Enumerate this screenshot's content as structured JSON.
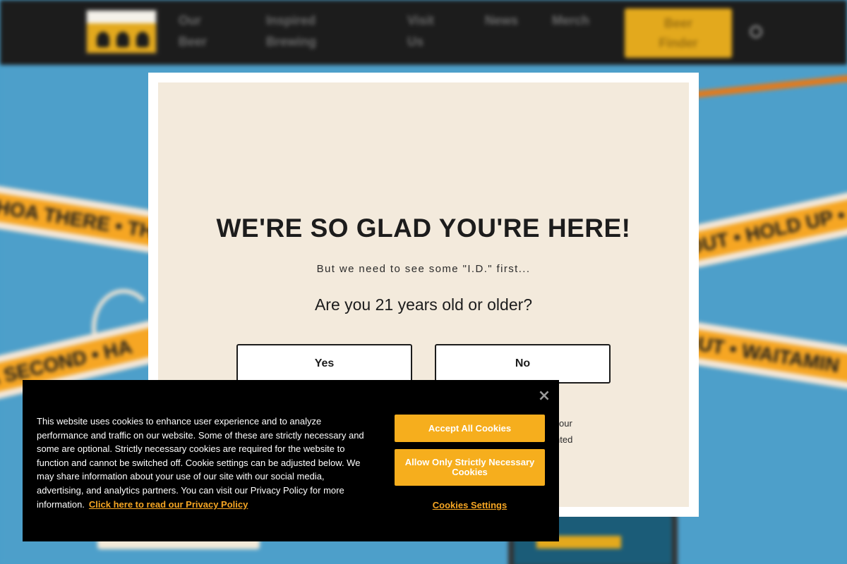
{
  "background": {
    "nav": {
      "items": [
        "Our Beer",
        "Inspired Brewing",
        "Visit Us",
        "News",
        "Merch"
      ],
      "beer_finder": "Beer Finder"
    },
    "tapes": {
      "left_top": "WHOA THERE • TH",
      "left_bottom": "A SECOND • HA",
      "right_top": "OUT • HOLD UP •",
      "right_bottom": "OUT • WAITAMIN"
    }
  },
  "age_gate": {
    "heading": "WE'RE SO GLAD YOU'RE HERE!",
    "subheading": "But we need to see some \"I.D.\" first...",
    "question": "Are you 21 years old or older?",
    "yes_label": "Yes",
    "no_label": "No",
    "fine_print_line1": "our",
    "fine_print_line2": "nted"
  },
  "cookie_banner": {
    "text": "This website uses cookies to enhance user experience and to analyze performance and traffic on our website. Some of these are strictly necessary and some are optional. Strictly necessary cookies are required for the website to function and cannot be switched off. Cookie settings can be adjusted below. We may share information about your use of our site with our social media, advertising, and analytics partners. You can visit our Privacy Policy for more information.",
    "privacy_link": "Click here to read our Privacy Policy",
    "accept_all": "Accept All Cookies",
    "strictly_necessary": "Allow Only Strictly Necessary Cookies",
    "settings": "Cookies Settings",
    "close_glyph": "×"
  },
  "colors": {
    "accent": "#f6a623",
    "modal_bg": "#f3eadc",
    "header_bg": "#1c1c1c"
  }
}
